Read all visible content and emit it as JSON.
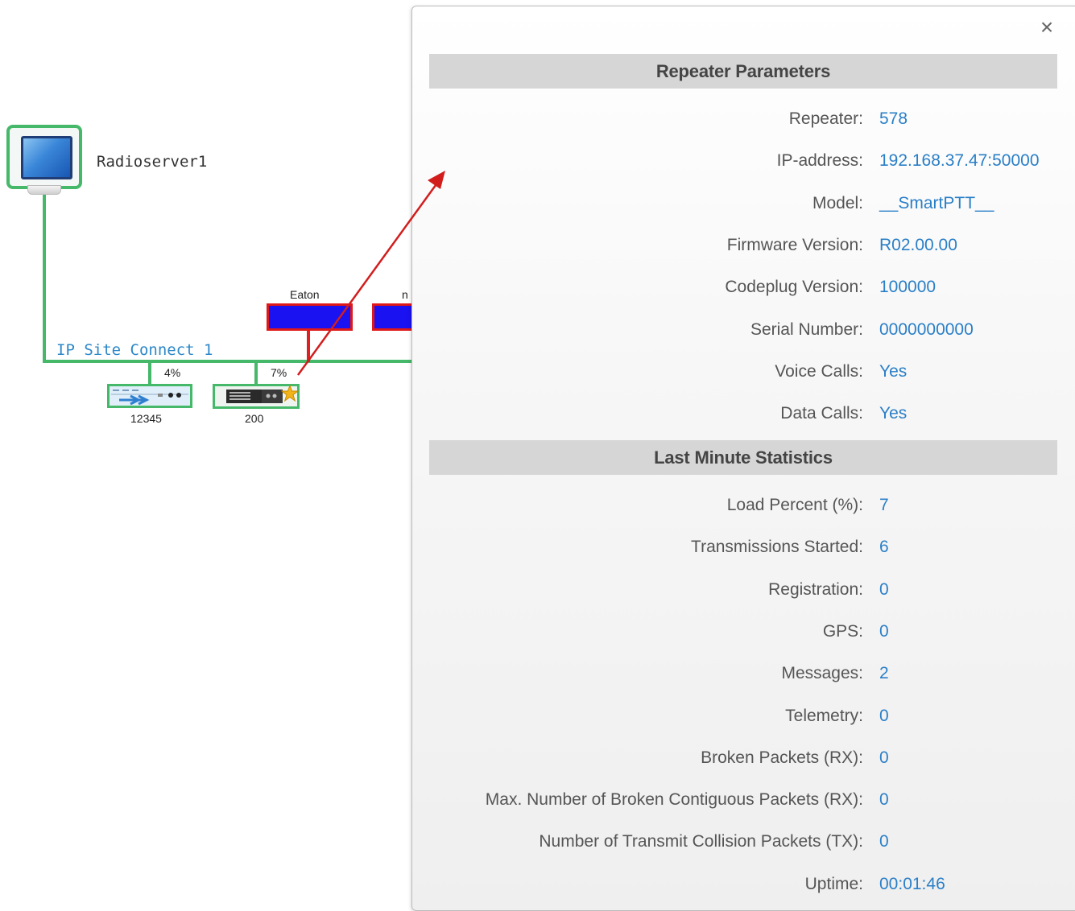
{
  "topology": {
    "server": {
      "name": "Radioserver1",
      "icon": "monitor-icon"
    },
    "site": {
      "name": "IP Site Connect 1"
    },
    "devices": [
      {
        "id": "12345",
        "load": "4%",
        "icon": "repeater-icon"
      },
      {
        "id": "200",
        "load": "7%",
        "icon": "repeater-icon",
        "badge_icon": "star-icon"
      }
    ],
    "nodes": [
      {
        "label": "Eaton"
      },
      {
        "label": "n"
      }
    ],
    "colors": {
      "link": "#46b86a",
      "alert": "#e02020",
      "node_fill": "#1a12f0"
    }
  },
  "panel": {
    "close_label": "×",
    "repeater_section": {
      "title": "Repeater Parameters",
      "rows": [
        {
          "label": "Repeater:",
          "value": "578"
        },
        {
          "label": "IP-address:",
          "value": "192.168.37.47:50000"
        },
        {
          "label": "Model:",
          "value": "__SmartPTT__"
        },
        {
          "label": "Firmware Version:",
          "value": "R02.00.00"
        },
        {
          "label": "Codeplug Version:",
          "value": "100000"
        },
        {
          "label": "Serial Number:",
          "value": "0000000000"
        },
        {
          "label": "Voice Calls:",
          "value": "Yes"
        },
        {
          "label": "Data Calls:",
          "value": "Yes"
        }
      ]
    },
    "stats_section": {
      "title": "Last Minute Statistics",
      "rows": [
        {
          "label": "Load Percent (%):",
          "value": "7"
        },
        {
          "label": "Transmissions Started:",
          "value": "6"
        },
        {
          "label": "Registration:",
          "value": "0"
        },
        {
          "label": "GPS:",
          "value": "0"
        },
        {
          "label": "Messages:",
          "value": "2"
        },
        {
          "label": "Telemetry:",
          "value": "0"
        },
        {
          "label": "Broken Packets (RX):",
          "value": "0"
        },
        {
          "label": "Max. Number of Broken Contiguous Packets (RX):",
          "value": "0"
        },
        {
          "label": "Number of Transmit Collision Packets (TX):",
          "value": "0"
        },
        {
          "label": "Uptime:",
          "value": "00:01:46"
        }
      ]
    }
  }
}
